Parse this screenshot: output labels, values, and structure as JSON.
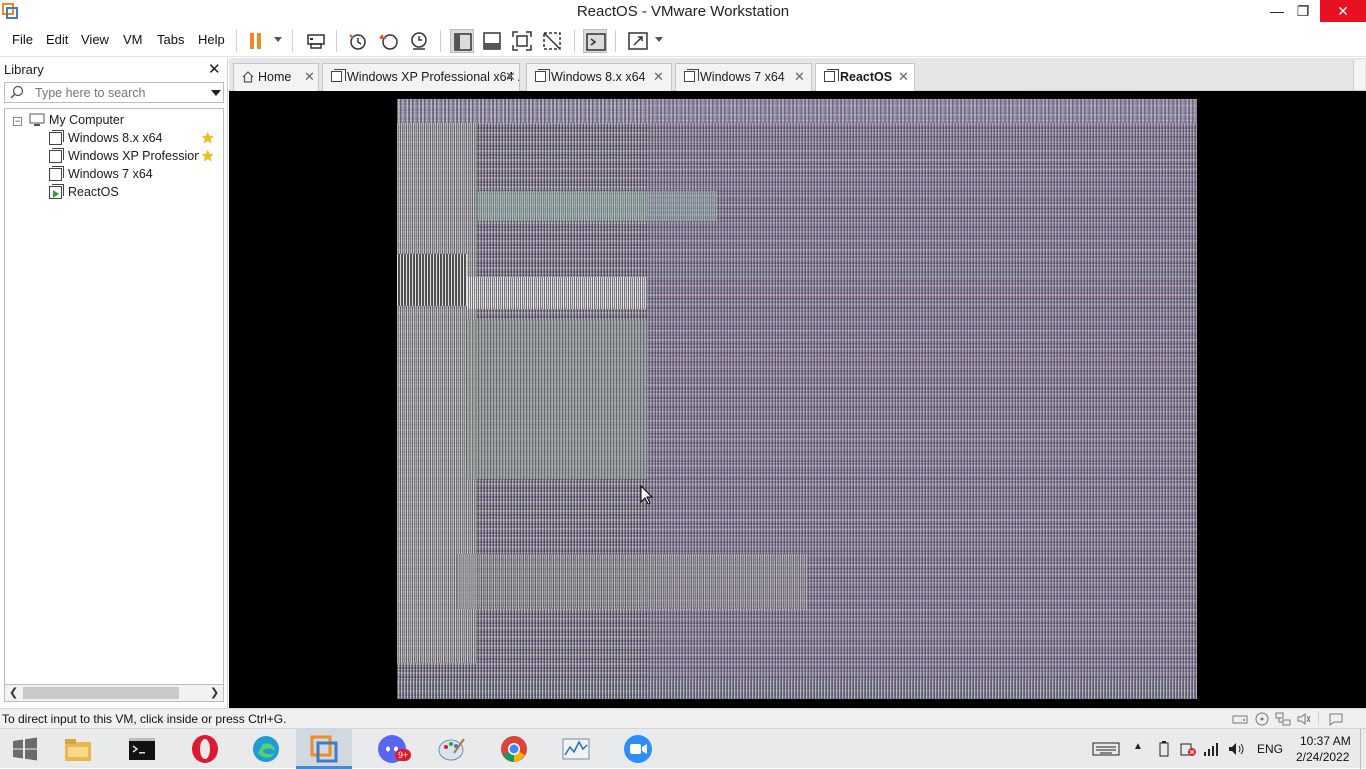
{
  "window": {
    "title": "ReactOS - VMware Workstation",
    "minimize_glyph": "—",
    "maximize_glyph": "❐",
    "close_glyph": "✕"
  },
  "menu": {
    "items": [
      "File",
      "Edit",
      "View",
      "VM",
      "Tabs",
      "Help"
    ]
  },
  "toolbar": {
    "icons": [
      "pause-icon",
      "send-ctrl-alt-del-icon",
      "snapshot-take-icon",
      "snapshot-revert-icon",
      "snapshot-manager-icon",
      "show-library-icon",
      "thumbnail-bar-icon",
      "full-screen-icon",
      "unity-icon",
      "console-view-icon",
      "stretch-guest-icon"
    ]
  },
  "library": {
    "title": "Library",
    "close_glyph": "✕",
    "search_placeholder": "Type here to search",
    "root": "My Computer",
    "root_expander": "−",
    "vms": [
      {
        "name": "Windows 8.x x64",
        "favorite": true
      },
      {
        "name": "Windows XP Professiona",
        "favorite": true
      },
      {
        "name": "Windows 7 x64",
        "favorite": false
      },
      {
        "name": "ReactOS",
        "favorite": false,
        "running": true
      }
    ],
    "scroll_left": "❮",
    "scroll_right": "❯"
  },
  "tabs": [
    {
      "label": "Home",
      "active": false
    },
    {
      "label": "Windows XP Professional x64 ...",
      "active": false
    },
    {
      "label": "Windows 8.x x64",
      "active": false
    },
    {
      "label": "Windows 7 x64",
      "active": false
    },
    {
      "label": "ReactOS",
      "active": true
    }
  ],
  "tab_close_glyph": "✕",
  "status": {
    "message": "To direct input to this VM, click inside or press Ctrl+G."
  },
  "taskbar": {
    "apps": [
      "windows-start-icon",
      "file-explorer-icon",
      "command-prompt-icon",
      "opera-icon",
      "edge-icon",
      "vmware-icon",
      "discord-icon",
      "paint-icon",
      "chrome-icon",
      "performance-monitor-icon",
      "zoom-icon"
    ],
    "discord_badge": "9+",
    "language": "ENG",
    "time": "10:37 AM",
    "date": "2/24/2022"
  },
  "colors": {
    "accent": "#4b89c9",
    "close_red": "#e81123",
    "pause_orange": "#f08a24",
    "star_yellow": "#f2c200"
  }
}
